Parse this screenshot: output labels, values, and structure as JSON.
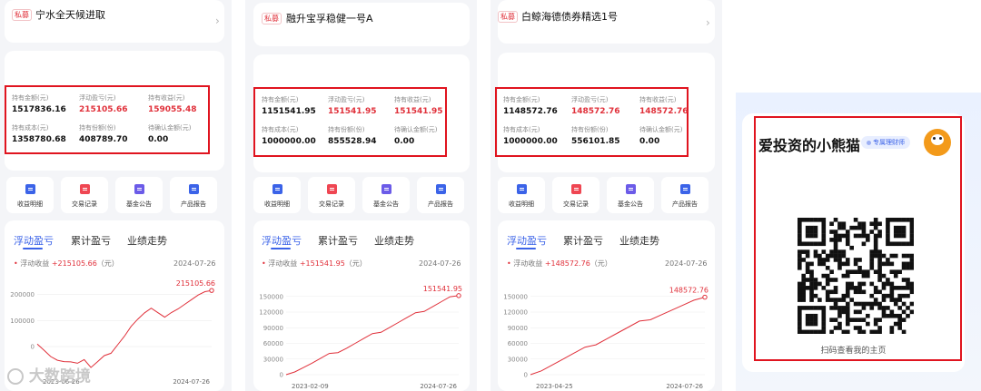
{
  "funds": [
    {
      "tag": "私募",
      "name": "宁水全天候进取",
      "holdings": [
        {
          "label": "持有金额(元)",
          "value": "1517836.16",
          "red": false
        },
        {
          "label": "浮动盈亏(元)",
          "value": "215105.66",
          "red": true
        },
        {
          "label": "持有收益(元)",
          "value": "159055.48",
          "red": true
        },
        {
          "label": "持有成本(元)",
          "value": "1358780.68",
          "red": false
        },
        {
          "label": "持有份额(份)",
          "value": "408789.70",
          "red": false
        },
        {
          "label": "待确认金额(元)",
          "value": "0.00",
          "red": false
        }
      ],
      "actions": [
        "收益明细",
        "交易记录",
        "基金公告",
        "产品报告"
      ],
      "tabs": [
        "浮动盈亏",
        "累计盈亏",
        "业绩走势"
      ],
      "legend_label": "浮动收益",
      "legend_value": "+215105.66",
      "legend_unit": "（元）",
      "legend_date": "2024-07-26",
      "chart_data": {
        "type": "line",
        "title": "",
        "series": [
          {
            "values": [
              10000,
              -8000,
              -35000,
              -52000,
              -60000,
              -64000,
              -58000,
              -47000,
              -80000,
              -60000,
              -40000,
              -20000,
              10000,
              40000,
              75000,
              100000,
              135000,
              150000,
              130000,
              110000,
              125000,
              150000,
              165000,
              180000,
              195000,
              205000,
              215105.66
            ]
          }
        ],
        "x_labels": [
          "2023-06-26",
          "2024-07-26"
        ],
        "y_ticks": [
          "200000",
          "100000",
          "0"
        ],
        "ylim": [
          -90000,
          240000
        ],
        "last_label": "215105.66"
      }
    },
    {
      "tag": "私募",
      "name": "融升宝孚稳健一号A",
      "holdings": [
        {
          "label": "持有金额(元)",
          "value": "1151541.95",
          "red": false
        },
        {
          "label": "浮动盈亏(元)",
          "value": "151541.95",
          "red": true
        },
        {
          "label": "持有收益(元)",
          "value": "151541.95",
          "red": true
        },
        {
          "label": "持有成本(元)",
          "value": "1000000.00",
          "red": false
        },
        {
          "label": "持有份额(份)",
          "value": "855528.94",
          "red": false
        },
        {
          "label": "待确认金额(元)",
          "value": "0.00",
          "red": false
        }
      ],
      "actions": [
        "收益明细",
        "交易记录",
        "基金公告",
        "产品报告"
      ],
      "tabs": [
        "浮动盈亏",
        "累计盈亏",
        "业绩走势"
      ],
      "legend_label": "浮动收益",
      "legend_value": "+151541.95",
      "legend_unit": "（元）",
      "legend_date": "2024-07-26",
      "chart_data": {
        "type": "line",
        "title": "",
        "series": [
          {
            "values": [
              0,
              8000,
              15000,
              22000,
              30000,
              38000,
              45000,
              52000,
              60000,
              68000,
              76000,
              84000,
              92000,
              100000,
              108000,
              116000,
              124000,
              132000,
              140000,
              148000,
              151541.95
            ]
          }
        ],
        "x_labels": [
          "2023-02-09",
          "2024-07-26"
        ],
        "y_ticks": [
          "150000",
          "120000",
          "90000",
          "60000",
          "30000",
          "0"
        ],
        "ylim": [
          0,
          160000
        ],
        "last_label": "151541.95"
      }
    },
    {
      "tag": "私募",
      "name": "白鲸海德债券精选1号",
      "holdings": [
        {
          "label": "持有金额(元)",
          "value": "1148572.76",
          "red": false
        },
        {
          "label": "浮动盈亏(元)",
          "value": "148572.76",
          "red": true
        },
        {
          "label": "持有收益(元)",
          "value": "148572.76",
          "red": true
        },
        {
          "label": "持有成本(元)",
          "value": "1000000.00",
          "red": false
        },
        {
          "label": "持有份额(份)",
          "value": "556101.85",
          "red": false
        },
        {
          "label": "待确认金额(元)",
          "value": "0.00",
          "red": false
        }
      ],
      "actions": [
        "收益明细",
        "交易记录",
        "基金公告",
        "产品报告"
      ],
      "tabs": [
        "浮动盈亏",
        "累计盈亏",
        "业绩走势"
      ],
      "legend_label": "浮动收益",
      "legend_value": "+148572.76",
      "legend_unit": "（元）",
      "legend_date": "2024-07-26",
      "chart_data": {
        "type": "line",
        "title": "",
        "series": [
          {
            "values": [
              0,
              10000,
              20000,
              30000,
              40000,
              50000,
              60000,
              70000,
              80000,
              90000,
              100000,
              108000,
              116000,
              124000,
              132000,
              140000,
              148572.76
            ]
          }
        ],
        "x_labels": [
          "2023-04-25",
          "2024-07-26"
        ],
        "y_ticks": [
          "150000",
          "120000",
          "90000",
          "60000",
          "30000",
          "0"
        ],
        "ylim": [
          0,
          160000
        ],
        "last_label": "148572.76"
      }
    }
  ],
  "qr": {
    "title": "爱投资的小熊猫",
    "badge": "专属理财师",
    "caption": "扫码查看我的主页"
  },
  "watermark": "大数跨境",
  "colors": {
    "accent": "#3b63e8",
    "red": "#e0303a",
    "highlight_box": "#e0141f"
  }
}
